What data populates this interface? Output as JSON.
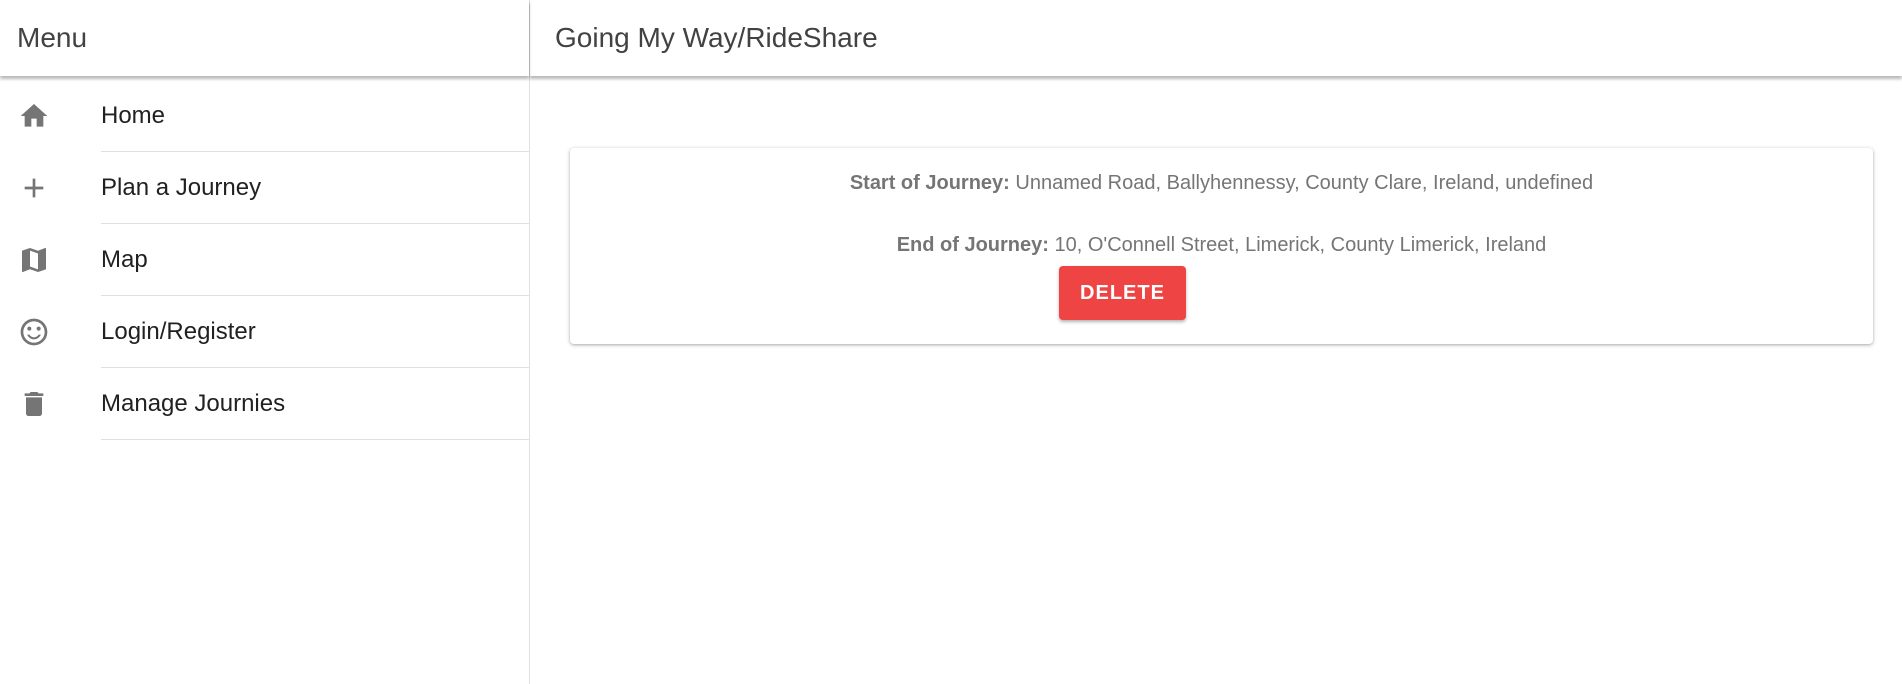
{
  "sidebar": {
    "title": "Menu",
    "items": [
      {
        "label": "Home",
        "icon": "home-icon"
      },
      {
        "label": "Plan a Journey",
        "icon": "plus-icon"
      },
      {
        "label": "Map",
        "icon": "map-icon"
      },
      {
        "label": "Login/Register",
        "icon": "smiley-icon"
      },
      {
        "label": "Manage Journies",
        "icon": "trash-icon"
      }
    ]
  },
  "header": {
    "title": "Going My Way/RideShare"
  },
  "journey": {
    "start_label": "Start of Journey:",
    "start_value": "Unnamed Road, Ballyhennessy, County Clare, Ireland, undefined",
    "end_label": "End of Journey:",
    "end_value": "10, O'Connell Street, Limerick, County Limerick, Ireland",
    "delete_label": "DELETE"
  },
  "colors": {
    "delete_button": "#ef4444",
    "icon": "#757575",
    "text": "#212121"
  }
}
